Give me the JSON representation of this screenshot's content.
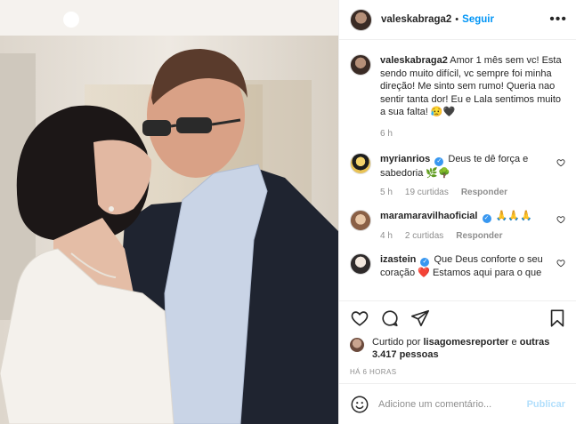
{
  "post": {
    "username": "valeskabraga2",
    "follow_label": "Seguir",
    "more_label": "•••",
    "caption": "Amor 1 mês sem vc! Esta sendo muito difícil, vc sempre foi minha direção! Me sinto sem rumo! Queria nao sentir tanta dor! Eu e Lala sentimos muito a sua falta! 😥🖤",
    "caption_time": "6 h"
  },
  "comments": [
    {
      "user": "myrianrios",
      "text": "Deus te dê força e sabedoria 🌿🌳",
      "time": "5 h",
      "likes": "19 curtidas",
      "reply": "Responder"
    },
    {
      "user": "maramaravilhaoficial",
      "text": "🙏🙏🙏",
      "time": "4 h",
      "likes": "2 curtidas",
      "reply": "Responder"
    },
    {
      "user": "izastein",
      "text": "Que Deus conforte o seu coração ❤️ Estamos aqui para o que",
      "time": "",
      "likes": "",
      "reply": ""
    }
  ],
  "likes": {
    "prefix": "Curtido por",
    "user": "lisagomesreporter",
    "connector": "e",
    "others": "outras 3.417 pessoas"
  },
  "time_ago": "HÁ 6 HORAS",
  "add_comment": {
    "placeholder": "Adicione um comentário...",
    "publish_label": "Publicar"
  },
  "icons": [
    "heart-icon",
    "comment-icon",
    "share-icon",
    "bookmark-icon",
    "emoji-icon",
    "more-icon",
    "verified-icon"
  ],
  "colors": {
    "link": "#0095f6",
    "verified": "#3897f0",
    "muted": "#8e8e8e",
    "publish_disabled": "#b2dffc"
  }
}
